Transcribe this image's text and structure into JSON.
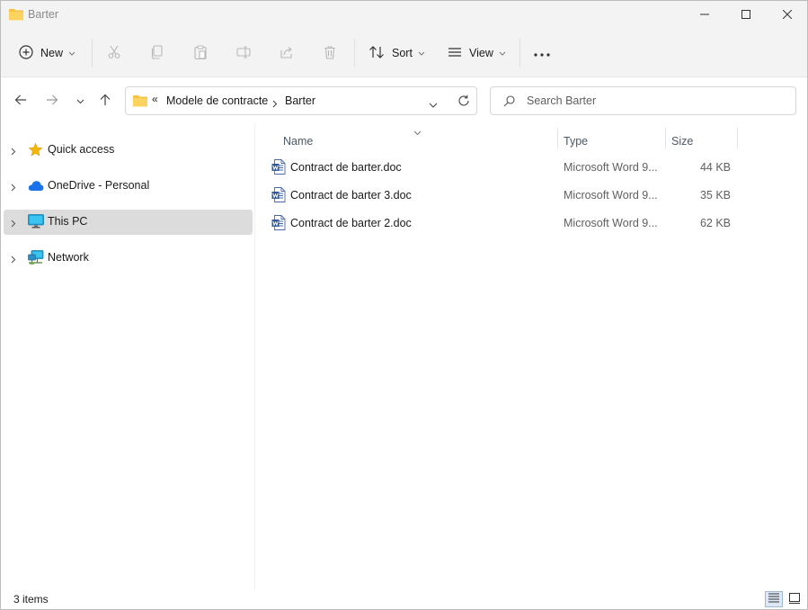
{
  "window": {
    "title": "Barter",
    "controls": {
      "minimize": "minimize",
      "maximize": "maximize",
      "close": "close"
    }
  },
  "toolbar": {
    "new_label": "New",
    "sort_label": "Sort",
    "view_label": "View",
    "more_label": "···"
  },
  "address": {
    "overflow": "«",
    "crumbs": [
      "Modele de contracte",
      "Barter"
    ]
  },
  "search": {
    "placeholder": "Search Barter"
  },
  "nav": {
    "items": [
      {
        "label": "Quick access",
        "icon": "star-icon",
        "selected": false
      },
      {
        "label": "OneDrive - Personal",
        "icon": "cloud-icon",
        "selected": false
      },
      {
        "label": "This PC",
        "icon": "monitor-icon",
        "selected": true
      },
      {
        "label": "Network",
        "icon": "network-icon",
        "selected": false
      }
    ]
  },
  "columns": {
    "name": "Name",
    "type": "Type",
    "size": "Size"
  },
  "files": [
    {
      "name": "Contract de barter.doc",
      "type": "Microsoft Word 9...",
      "size": "44 KB",
      "icon": "word-doc-icon"
    },
    {
      "name": "Contract de barter 3.doc",
      "type": "Microsoft Word 9...",
      "size": "35 KB",
      "icon": "word-doc-icon"
    },
    {
      "name": "Contract de barter 2.doc",
      "type": "Microsoft Word 9...",
      "size": "62 KB",
      "icon": "word-doc-icon"
    }
  ],
  "status": {
    "items_text": "3 items"
  },
  "colors": {
    "folder": "#f5c242",
    "accent": "#0067c0",
    "selected_nav": "#dcdcdc",
    "word_blue": "#2b579a"
  }
}
